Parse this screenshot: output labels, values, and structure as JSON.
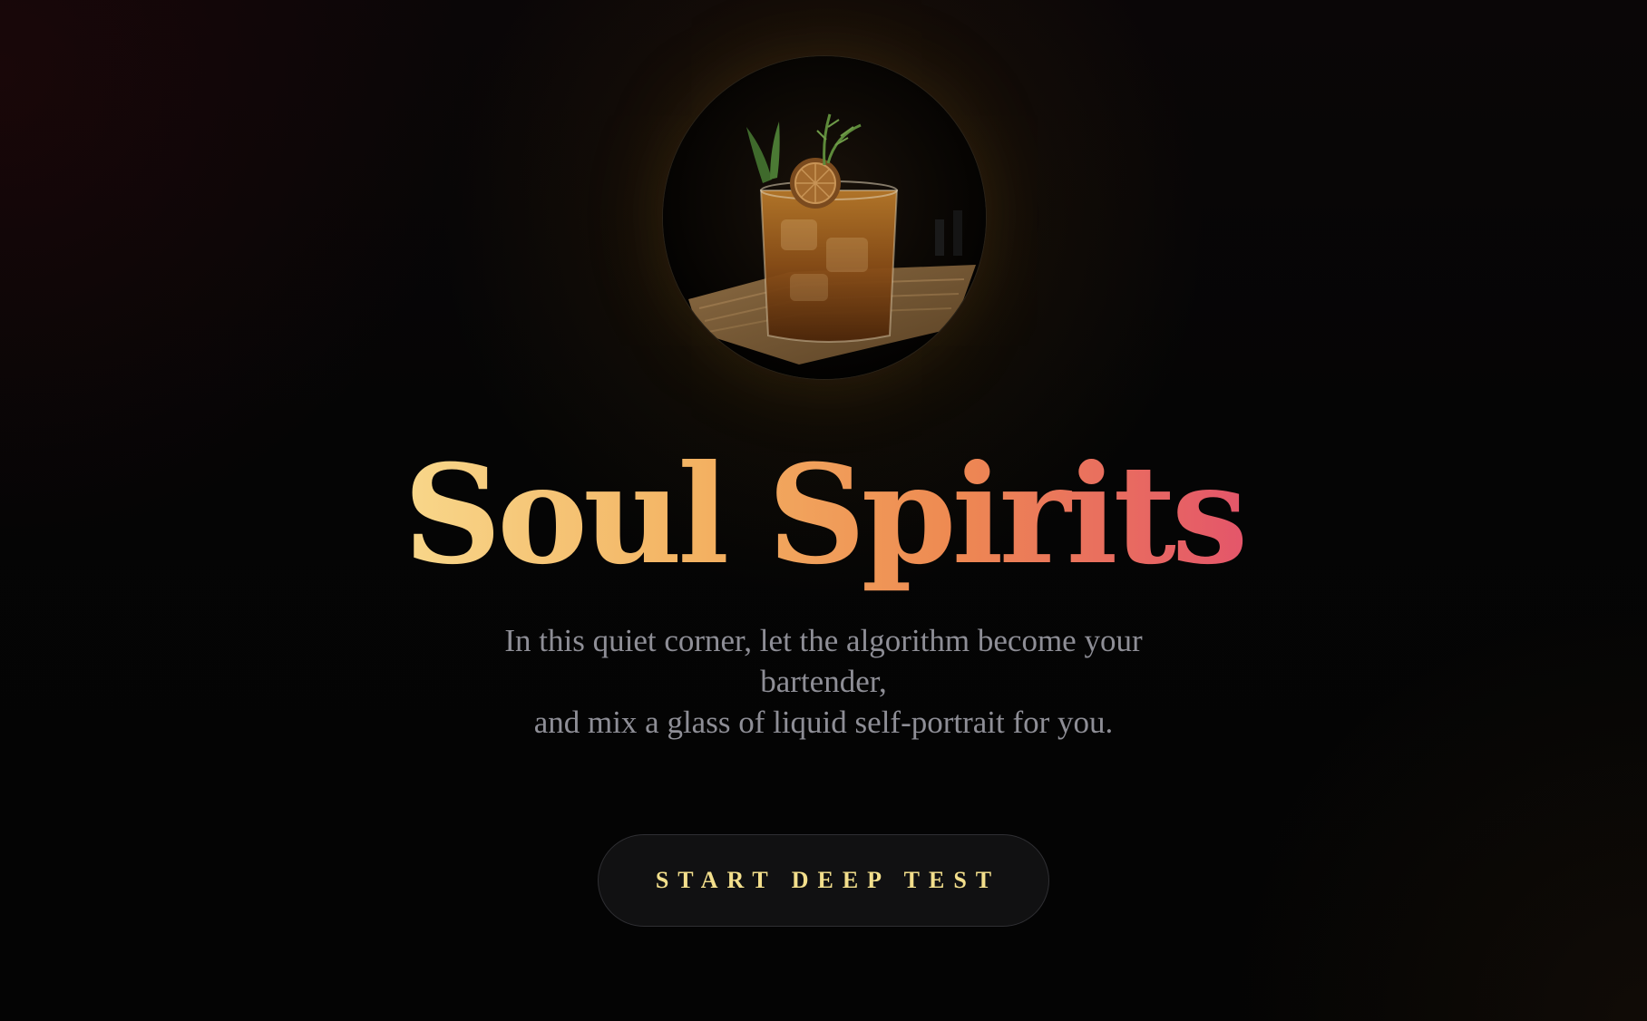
{
  "hero": {
    "image_alt": "Cocktail glass with garnish",
    "title": "Soul Spirits",
    "subtitle_lines": [
      "In this quiet corner, let the algorithm become your",
      "bartender,",
      "and mix a glass of liquid self-portrait for you."
    ]
  },
  "cta": {
    "label": "START DEEP TEST"
  },
  "colors": {
    "background": "#050505",
    "title_gradient_start": "#f8d78a",
    "title_gradient_end": "#e4566a",
    "subtitle": "#8e8e96",
    "button_text": "#f3df8c",
    "button_bg": "#111112"
  }
}
